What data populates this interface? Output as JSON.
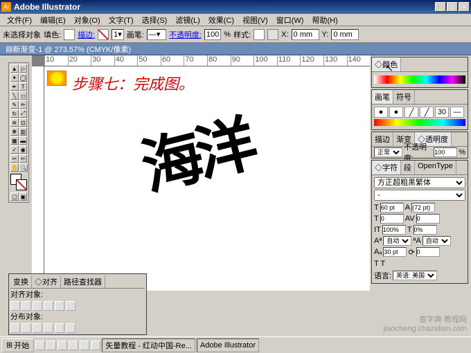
{
  "app": {
    "title": "Adobe Illustrator"
  },
  "window_buttons": {
    "min": "_",
    "max": "□",
    "close": "×"
  },
  "menu": [
    "文件(F)",
    "编辑(E)",
    "对象(O)",
    "文字(T)",
    "选择(S)",
    "滤镜(L)",
    "效果(C)",
    "视图(V)",
    "窗口(W)",
    "帮助(H)"
  ],
  "options": {
    "sel_label": "未选择对象",
    "fill_label": "填色:",
    "stroke_label": "描边:",
    "stroke_wt": "1",
    "brush_label": "画笔:",
    "opacity_label": "不透明度:",
    "opacity_val": "100",
    "pct": "%",
    "style_label": "样式:",
    "x_label": "X:",
    "x_val": "0 mm",
    "y_label": "Y:",
    "y_val": "0 mm"
  },
  "doc": {
    "tab": "新渐变-1 @ 273.57% (CMYK/像素)"
  },
  "ruler_marks": [
    "10",
    "20",
    "30",
    "40",
    "50",
    "60",
    "70",
    "80",
    "90",
    "100",
    "110",
    "120",
    "130",
    "140"
  ],
  "canvas": {
    "annotation": "步骤七：完成图。",
    "art_text": "海洋"
  },
  "panel_color": {
    "tab": "◇颜色"
  },
  "panel_brush": {
    "tabs": [
      "画笔",
      "符号"
    ],
    "brush_vals": [
      "●",
      "●",
      "╱",
      "╱",
      "30",
      "―"
    ]
  },
  "panel_trans": {
    "tabs": [
      "描边",
      "渐变",
      "◇透明度"
    ],
    "mode": "正常",
    "opacity_label": "不透明度:",
    "opacity_val": "100",
    "pct": "%"
  },
  "panel_char": {
    "tabs": [
      "◇字符",
      "段",
      "OpenType"
    ],
    "font": "方正超粗黑繁体",
    "size_val": "60 pt",
    "leading_val": "(72 pt)",
    "kern_val": "0",
    "track_val": "0",
    "hscale": "100%",
    "vscale": "0%",
    "baseline_label": "自动",
    "baseline_val": "自动",
    "shift_val": "30 pt",
    "rotate_val": "0",
    "t_icons": "T  T",
    "lang_label": "语言:",
    "lang_val": "英语: 美国"
  },
  "panel_align": {
    "tabs": [
      "变换",
      "◇对齐",
      "路径查找器"
    ],
    "row1": "对齐对象:",
    "row2": "分布对象:"
  },
  "taskbar": {
    "start": "开始",
    "tasks": [
      "矢量教程 - 红动中国-Re...",
      "Adobe Illustrator"
    ]
  },
  "watermark": {
    "line1": "查字典 教程网",
    "line2": "jiaocheng.chazidian.com"
  }
}
